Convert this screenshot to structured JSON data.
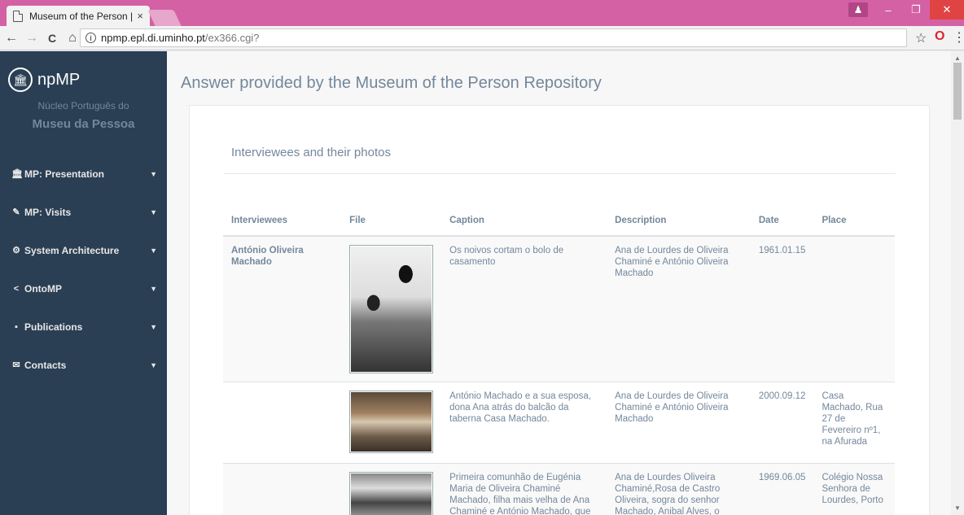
{
  "browser": {
    "tab_title": "Museum of the Person |",
    "tab_close": "×",
    "url_domain": "npmp.epl.di.uminho.pt",
    "url_path": "/ex366.cgi?",
    "back": "←",
    "forward": "→",
    "reload": "C",
    "home": "⌂",
    "star": "☆",
    "opera": "O",
    "menu": "⋮"
  },
  "sidebar": {
    "brand_name": "npMP",
    "brand_sub": "Núcleo Português do",
    "brand_main": "Museu da Pessoa",
    "items": [
      {
        "icon": "🏛",
        "label": "MP: Presentation"
      },
      {
        "icon": "✎",
        "label": "MP: Visits"
      },
      {
        "icon": "⚙",
        "label": "System Architecture"
      },
      {
        "icon": "<",
        "label": "OntoMP"
      },
      {
        "icon": "▪",
        "label": "Publications"
      },
      {
        "icon": "✉",
        "label": "Contacts"
      }
    ]
  },
  "main": {
    "page_title": "Answer provided by the Museum of the Person Repository",
    "panel_title": "Interviewees and their photos",
    "columns": [
      "Interviewees",
      "File",
      "Caption",
      "Description",
      "Date",
      "Place"
    ],
    "rows": [
      {
        "interviewee": "António Oliveira Machado",
        "caption": "Os noivos cortam o bolo de casamento",
        "description": "Ana de Lourdes de Oliveira Chaminé e António Oliveira Machado",
        "date": "1961.01.15",
        "place": ""
      },
      {
        "interviewee": "",
        "caption": "António Machado e a sua esposa, dona Ana atrás do balcão da taberna Casa Machado.",
        "description": "Ana de Lourdes de Oliveira Chaminé e António Oliveira Machado",
        "date": "2000.09.12",
        "place": "Casa Machado, Rua 27 de Fevereiro nº1, na Afurada"
      },
      {
        "interviewee": "",
        "caption": "Primeira comunhão de Eugénia Maria de Oliveira Chaminé Machado, filha mais velha de Ana Chaminé e António Machado, que se relaizou no",
        "description": "Ana de Lourdes Oliveira Chaminé,Rosa de Castro Oliveira, sogra do senhor Machado, Anibal Alves, o",
        "date": "1969.06.05",
        "place": "Colégio Nossa Senhora de Lourdes, Porto"
      }
    ]
  }
}
